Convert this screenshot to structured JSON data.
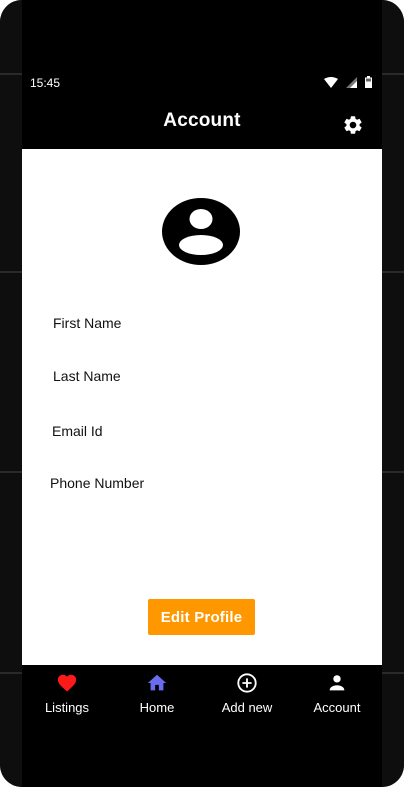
{
  "status_bar": {
    "time": "15:45"
  },
  "app_bar": {
    "title": "Account",
    "settings_icon": "gear-icon"
  },
  "profile": {
    "avatar_icon": "account-circle-icon",
    "fields": {
      "first_name_label": "First  Name",
      "last_name_label": "Last Name",
      "email_label": "Email Id",
      "phone_label": "Phone Number"
    },
    "edit_button_label": "Edit Profile"
  },
  "bottom_nav": {
    "items": [
      {
        "label": "Listings",
        "icon": "heart-icon",
        "color": "#ff1a1a"
      },
      {
        "label": "Home",
        "icon": "home-icon",
        "color": "#6a6cf0"
      },
      {
        "label": "Add new",
        "icon": "add-circle-icon",
        "color": "#ffffff"
      },
      {
        "label": "Account",
        "icon": "person-icon",
        "color": "#ffffff"
      }
    ]
  },
  "colors": {
    "accent": "#ff9800",
    "background": "#000000",
    "surface": "#ffffff"
  }
}
